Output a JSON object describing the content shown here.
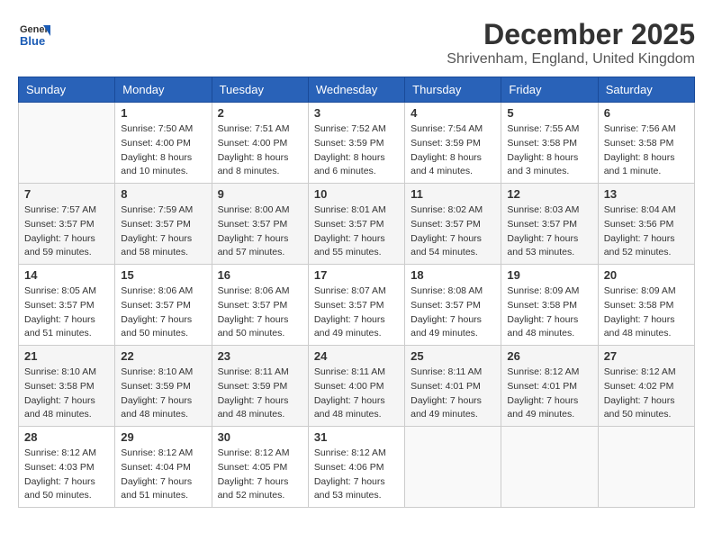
{
  "header": {
    "logo_general": "General",
    "logo_blue": "Blue",
    "month": "December 2025",
    "location": "Shrivenham, England, United Kingdom"
  },
  "columns": [
    "Sunday",
    "Monday",
    "Tuesday",
    "Wednesday",
    "Thursday",
    "Friday",
    "Saturday"
  ],
  "weeks": [
    [
      {
        "day": "",
        "info": ""
      },
      {
        "day": "1",
        "info": "Sunrise: 7:50 AM\nSunset: 4:00 PM\nDaylight: 8 hours\nand 10 minutes."
      },
      {
        "day": "2",
        "info": "Sunrise: 7:51 AM\nSunset: 4:00 PM\nDaylight: 8 hours\nand 8 minutes."
      },
      {
        "day": "3",
        "info": "Sunrise: 7:52 AM\nSunset: 3:59 PM\nDaylight: 8 hours\nand 6 minutes."
      },
      {
        "day": "4",
        "info": "Sunrise: 7:54 AM\nSunset: 3:59 PM\nDaylight: 8 hours\nand 4 minutes."
      },
      {
        "day": "5",
        "info": "Sunrise: 7:55 AM\nSunset: 3:58 PM\nDaylight: 8 hours\nand 3 minutes."
      },
      {
        "day": "6",
        "info": "Sunrise: 7:56 AM\nSunset: 3:58 PM\nDaylight: 8 hours\nand 1 minute."
      }
    ],
    [
      {
        "day": "7",
        "info": "Sunrise: 7:57 AM\nSunset: 3:57 PM\nDaylight: 7 hours\nand 59 minutes."
      },
      {
        "day": "8",
        "info": "Sunrise: 7:59 AM\nSunset: 3:57 PM\nDaylight: 7 hours\nand 58 minutes."
      },
      {
        "day": "9",
        "info": "Sunrise: 8:00 AM\nSunset: 3:57 PM\nDaylight: 7 hours\nand 57 minutes."
      },
      {
        "day": "10",
        "info": "Sunrise: 8:01 AM\nSunset: 3:57 PM\nDaylight: 7 hours\nand 55 minutes."
      },
      {
        "day": "11",
        "info": "Sunrise: 8:02 AM\nSunset: 3:57 PM\nDaylight: 7 hours\nand 54 minutes."
      },
      {
        "day": "12",
        "info": "Sunrise: 8:03 AM\nSunset: 3:57 PM\nDaylight: 7 hours\nand 53 minutes."
      },
      {
        "day": "13",
        "info": "Sunrise: 8:04 AM\nSunset: 3:56 PM\nDaylight: 7 hours\nand 52 minutes."
      }
    ],
    [
      {
        "day": "14",
        "info": "Sunrise: 8:05 AM\nSunset: 3:57 PM\nDaylight: 7 hours\nand 51 minutes."
      },
      {
        "day": "15",
        "info": "Sunrise: 8:06 AM\nSunset: 3:57 PM\nDaylight: 7 hours\nand 50 minutes."
      },
      {
        "day": "16",
        "info": "Sunrise: 8:06 AM\nSunset: 3:57 PM\nDaylight: 7 hours\nand 50 minutes."
      },
      {
        "day": "17",
        "info": "Sunrise: 8:07 AM\nSunset: 3:57 PM\nDaylight: 7 hours\nand 49 minutes."
      },
      {
        "day": "18",
        "info": "Sunrise: 8:08 AM\nSunset: 3:57 PM\nDaylight: 7 hours\nand 49 minutes."
      },
      {
        "day": "19",
        "info": "Sunrise: 8:09 AM\nSunset: 3:58 PM\nDaylight: 7 hours\nand 48 minutes."
      },
      {
        "day": "20",
        "info": "Sunrise: 8:09 AM\nSunset: 3:58 PM\nDaylight: 7 hours\nand 48 minutes."
      }
    ],
    [
      {
        "day": "21",
        "info": "Sunrise: 8:10 AM\nSunset: 3:58 PM\nDaylight: 7 hours\nand 48 minutes."
      },
      {
        "day": "22",
        "info": "Sunrise: 8:10 AM\nSunset: 3:59 PM\nDaylight: 7 hours\nand 48 minutes."
      },
      {
        "day": "23",
        "info": "Sunrise: 8:11 AM\nSunset: 3:59 PM\nDaylight: 7 hours\nand 48 minutes."
      },
      {
        "day": "24",
        "info": "Sunrise: 8:11 AM\nSunset: 4:00 PM\nDaylight: 7 hours\nand 48 minutes."
      },
      {
        "day": "25",
        "info": "Sunrise: 8:11 AM\nSunset: 4:01 PM\nDaylight: 7 hours\nand 49 minutes."
      },
      {
        "day": "26",
        "info": "Sunrise: 8:12 AM\nSunset: 4:01 PM\nDaylight: 7 hours\nand 49 minutes."
      },
      {
        "day": "27",
        "info": "Sunrise: 8:12 AM\nSunset: 4:02 PM\nDaylight: 7 hours\nand 50 minutes."
      }
    ],
    [
      {
        "day": "28",
        "info": "Sunrise: 8:12 AM\nSunset: 4:03 PM\nDaylight: 7 hours\nand 50 minutes."
      },
      {
        "day": "29",
        "info": "Sunrise: 8:12 AM\nSunset: 4:04 PM\nDaylight: 7 hours\nand 51 minutes."
      },
      {
        "day": "30",
        "info": "Sunrise: 8:12 AM\nSunset: 4:05 PM\nDaylight: 7 hours\nand 52 minutes."
      },
      {
        "day": "31",
        "info": "Sunrise: 8:12 AM\nSunset: 4:06 PM\nDaylight: 7 hours\nand 53 minutes."
      },
      {
        "day": "",
        "info": ""
      },
      {
        "day": "",
        "info": ""
      },
      {
        "day": "",
        "info": ""
      }
    ]
  ]
}
